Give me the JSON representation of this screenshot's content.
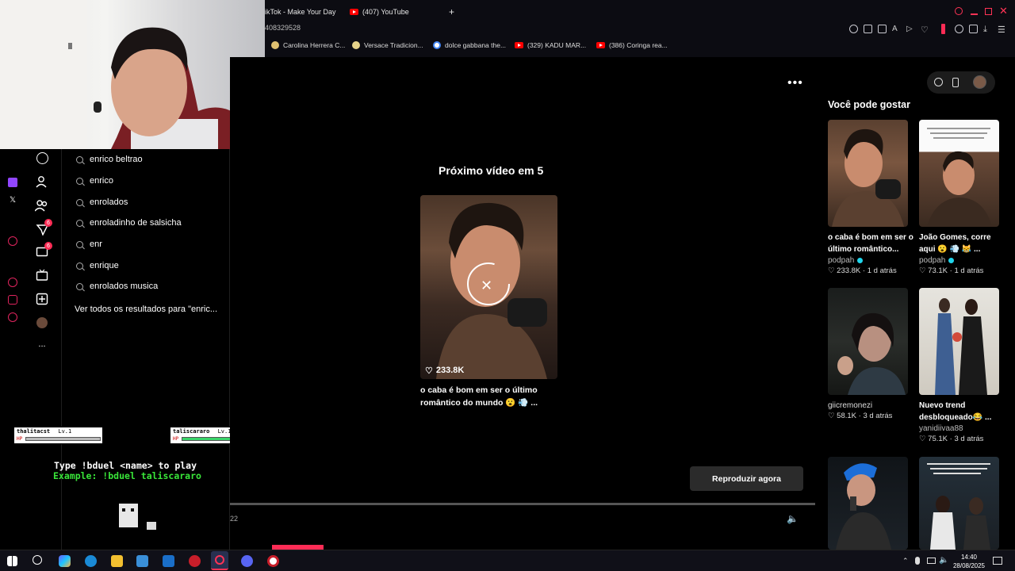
{
  "browser": {
    "tabs": [
      {
        "label": "ikTok - Make Your Day",
        "icon": "tiktok-icon"
      },
      {
        "label": "(407) YouTube",
        "icon": "youtube-icon"
      }
    ],
    "new_tab_symbol": "+",
    "address_fragment": "408329528",
    "bookmarks": [
      {
        "label": "Carolina Herrera C...",
        "color": "#e0c070"
      },
      {
        "label": "Versace Tradicion...",
        "color": "#e6d38a"
      },
      {
        "label": "dolce gabbana the...",
        "color": "#4285f4"
      },
      {
        "label": "(329) KADU MAR...",
        "color": "#ff0000"
      },
      {
        "label": "(386) Coringa rea...",
        "color": "#ff0000"
      }
    ]
  },
  "search": {
    "suggestions": [
      "enrico beltrao",
      "enrico",
      "enrolados",
      "enroladinho de salsicha",
      "enr",
      "enrique",
      "enrolados musica"
    ],
    "view_all": "Ver todos os resultados para \"enric..."
  },
  "nav": {
    "badges": {
      "inbox": "6",
      "messages": "6"
    },
    "more": "..."
  },
  "player": {
    "next_title": "Próximo vídeo em 5",
    "likes": "233.8K",
    "caption": "o caba é bom em ser o último romântico do mundo 😮 💨 ...",
    "play_now": "Reproduzir agora",
    "time": "22",
    "more_menu": "•••"
  },
  "recommendations": {
    "title": "Você pode gostar",
    "cards": [
      {
        "caption": "o caba é bom em ser o último romântico...",
        "author": "podpah",
        "verified": true,
        "likes": "233.8K",
        "age": "1 d atrás"
      },
      {
        "caption": "João Gomes, corre aqui 😮 💨 😹 ...",
        "author": "podpah",
        "verified": true,
        "likes": "73.1K",
        "age": "1 d atrás"
      },
      {
        "caption": "",
        "author": "giicremonezi",
        "verified": false,
        "likes": "58.1K",
        "age": "3 d atrás"
      },
      {
        "caption": "Nuevo trend desbloqueado😂 ...",
        "author": "yanidiivaa88",
        "verified": false,
        "likes": "75.1K",
        "age": "3 d atrás"
      }
    ]
  },
  "game": {
    "player1": {
      "name": "thalitacst",
      "level": "Lv.1",
      "hp_label": "HP",
      "hp": 1.0
    },
    "player2": {
      "name": "taliscararo",
      "level": "Lv.18",
      "hp_label": "HP",
      "hp": 1.0
    },
    "line1": "Type !bduel <name> to play",
    "line2": "Example: !bduel taliscararo"
  },
  "taskbar": {
    "time": "14:40",
    "date": "28/08/2025"
  }
}
